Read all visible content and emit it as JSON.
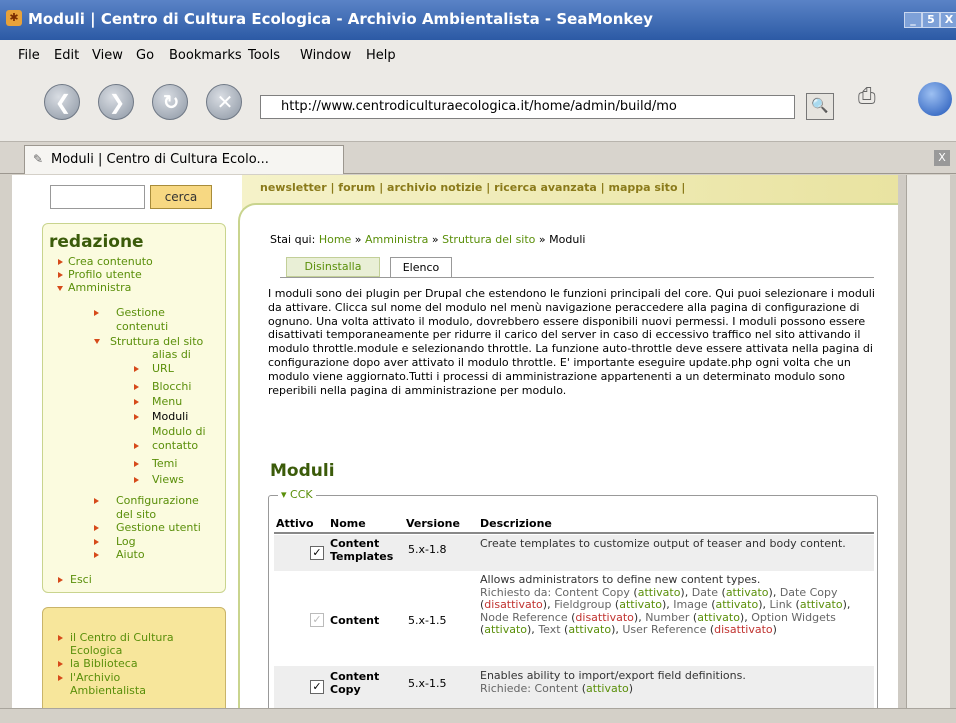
{
  "window": {
    "title": "Moduli | Centro di Cultura Ecologica - Archivio Ambientalista - SeaMonkey",
    "app_icon": "seamonkey-icon",
    "buttons": [
      "_",
      "5",
      "X"
    ]
  },
  "menu": [
    "File",
    "Edit",
    "View",
    "Go",
    "Bookmarks",
    "Tools",
    "Window",
    "Help"
  ],
  "nav": {
    "url": "http://www.centrodiculturaecologica.it/home/admin/build/mo",
    "back_glyph": "❮",
    "forward_glyph": "❯",
    "reload_glyph": "↻",
    "stop_glyph": "✕",
    "search_glyph": "🔍"
  },
  "tab": {
    "title": "Moduli | Centro di Cultura Ecolo...",
    "close": "X"
  },
  "sidebar": {
    "search_button": "cerca",
    "heading": "redazione",
    "items": [
      "Crea contenuto",
      "Profilo utente",
      "Amministra",
      "Gestione",
      "contenuti",
      "Struttura del sito",
      "alias di",
      "URL",
      "Blocchi",
      "Menu",
      "Moduli",
      "Modulo di",
      "contatto",
      "Temi",
      "Views",
      "Configurazione",
      "del sito",
      "Gestione utenti",
      "Log",
      "Aiuto",
      "Esci"
    ],
    "bottom_items": [
      "il Centro di Cultura",
      "Ecologica",
      "la Biblioteca",
      "l'Archivio",
      "Ambientalista"
    ]
  },
  "toplinks": "newsletter | forum | archivio notizie | ricerca avanzata | mappa sito |",
  "breadcrumb": {
    "prefix": "Stai qui:",
    "home": "Home",
    "sep": "»",
    "admin": "Amministra",
    "struct": "Struttura del sito",
    "current": "Moduli"
  },
  "local_tabs": [
    "Disinstalla",
    "Elenco"
  ],
  "intro": "I moduli sono dei plugin per Drupal che estendono le funzioni principali del core. Qui puoi selezionare i moduli da attivare. Clicca sul nome del modulo nel menù navigazione peraccedere alla pagina di configurazione di ognuno. Una volta attivato il modulo, dovrebbero essere disponibili nuovi permessi. I moduli possono essere disattivati temporaneamente per ridurre il carico del server in caso di eccessivo traffico nel sito attivando il modulo throttle.module e selezionando throttle. La funzione auto-throttle deve essere attivata nella pagina di configurazione dopo aver attivato il modulo throttle. E' importante eseguire update.php ogni volta che un modulo viene aggiornato.Tutti i processi di amministrazione appartenenti a un determinato modulo sono reperibili nella pagina di amministrazione per modulo.",
  "modules_heading": "Moduli",
  "group": "CCK",
  "table": {
    "headers": [
      "Attivo",
      "Nome",
      "Versione",
      "Descrizione"
    ],
    "rows": [
      {
        "name1": "Content",
        "name2": "Templates",
        "version": "5.x-1.8",
        "desc": "Create templates to customize output of teaser and body content.",
        "checked": "✓"
      },
      {
        "name1": "Content",
        "name2": "",
        "version": "5.x-1.5",
        "desc": "Allows administrators to define new content types.",
        "checked": "✓"
      },
      {
        "name1": "Content",
        "name2": "Copy",
        "version": "5.x-1.5",
        "desc": "Enables ability to import/export field definitions.",
        "checked": "✓"
      }
    ],
    "content_requires": {
      "label": "Richiesto da:",
      "items": [
        {
          "name": "Content Copy",
          "status": "attivato"
        },
        {
          "name": "Date",
          "status": "attivato"
        },
        {
          "name": "Date Copy",
          "status": "disattivato"
        },
        {
          "name": "Fieldgroup",
          "status": "attivato"
        },
        {
          "name": "Image",
          "status": "attivato"
        },
        {
          "name": "Link",
          "status": "attivato"
        },
        {
          "name": "Node Reference",
          "status": "disattivato"
        },
        {
          "name": "Number",
          "status": "attivato"
        },
        {
          "name": "Option Widgets",
          "status": "attivato"
        },
        {
          "name": "Text",
          "status": "attivato"
        },
        {
          "name": "User Reference",
          "status": "disattivato"
        }
      ]
    },
    "copy_requires": {
      "label": "Richiede:",
      "name": "Content",
      "status": "attivato"
    }
  },
  "colors": {
    "green": "#5a8f0a",
    "red": "#c0322f",
    "title_bar": "#2c5aa5"
  }
}
